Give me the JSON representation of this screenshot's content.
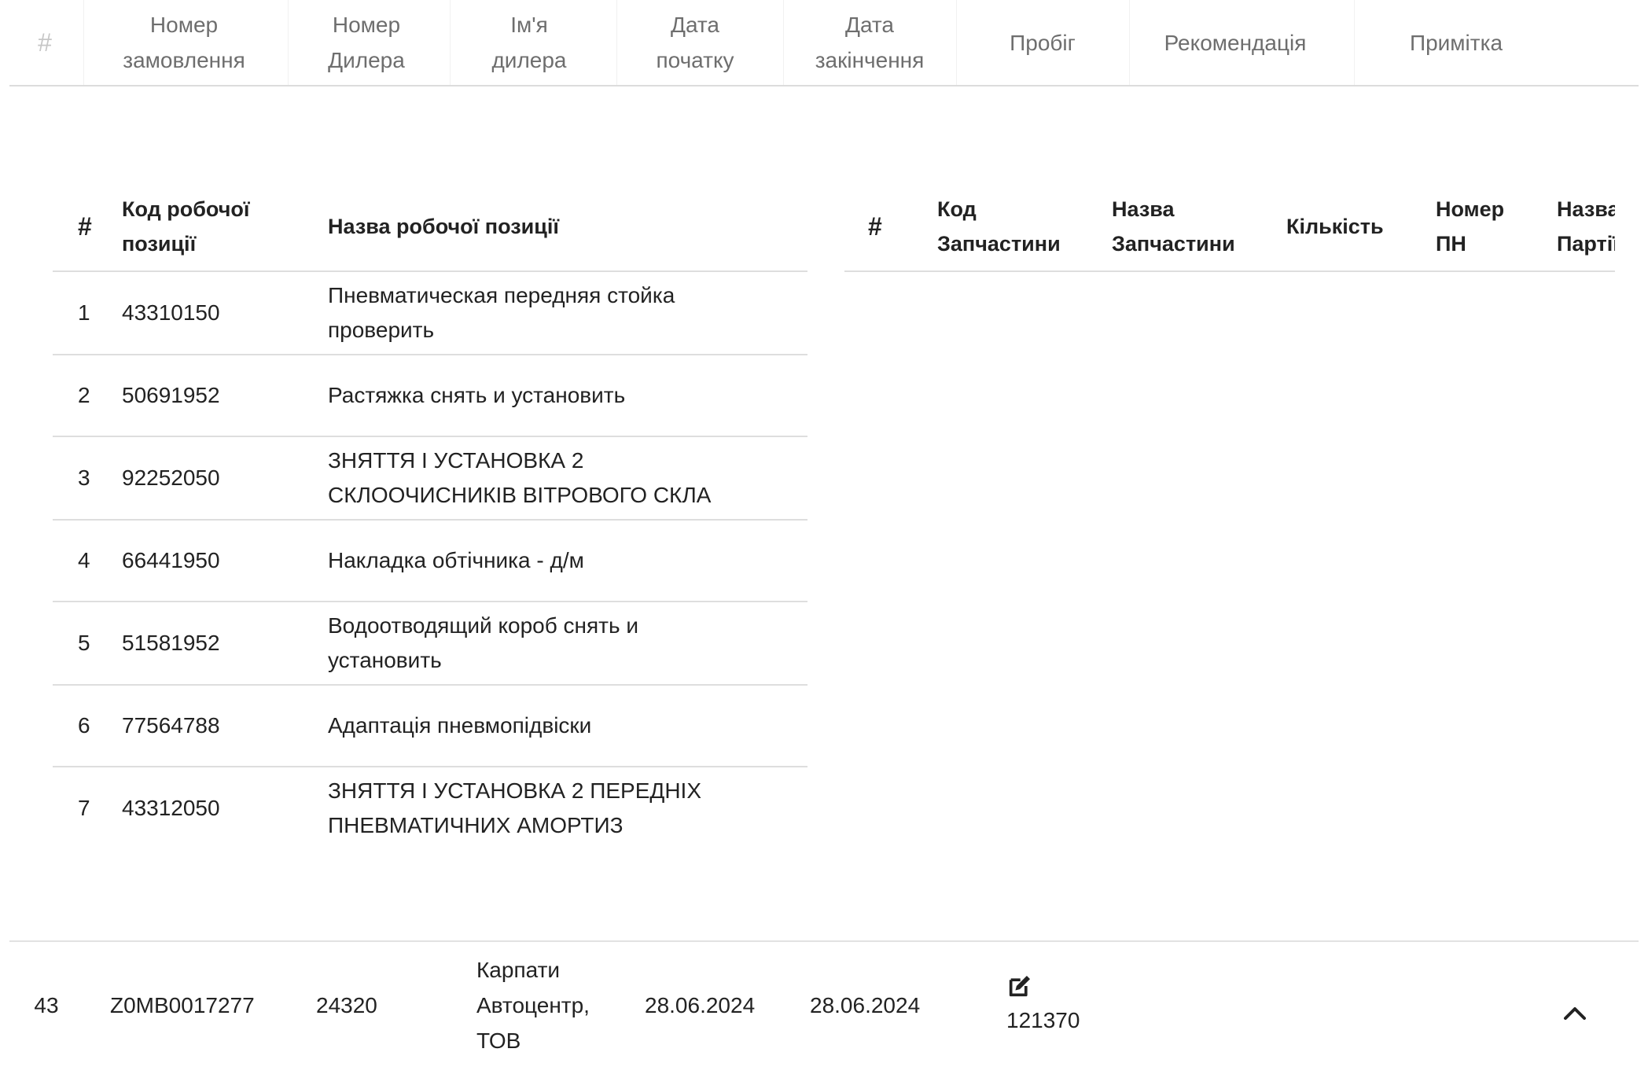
{
  "main_table": {
    "headers": {
      "hash": "#",
      "order_number": [
        "Номер",
        "замовлення"
      ],
      "dealer_number": [
        "Номер",
        "Дилера"
      ],
      "dealer_name": [
        "Ім'я",
        "дилера"
      ],
      "start_date": [
        "Дата",
        "початку"
      ],
      "end_date": [
        "Дата",
        "закінчення"
      ],
      "mileage": "Пробіг",
      "recommendation": "Рекомендація",
      "note": "Примітка"
    },
    "row": {
      "index": "43",
      "order_number": "Z0MB0017277",
      "dealer_number": "24320",
      "dealer_name": [
        "Карпати",
        "Автоцентр,",
        "ТОВ"
      ],
      "start_date": "28.06.2024",
      "end_date": "28.06.2024",
      "mileage": "121370",
      "edit_icon": "edit-icon",
      "collapse_icon": "chevron-up-icon"
    }
  },
  "works_table": {
    "headers": {
      "hash": "#",
      "code": [
        "Код робочої",
        "позиції"
      ],
      "name": "Назва робочої позиції"
    },
    "rows": [
      {
        "num": "1",
        "code": "43310150",
        "name": [
          "Пневматическая передняя стойка",
          "проверить"
        ]
      },
      {
        "num": "2",
        "code": "50691952",
        "name": [
          "Растяжка снять и установить"
        ]
      },
      {
        "num": "3",
        "code": "92252050",
        "name": [
          "ЗНЯТТЯ І УСТАНОВКА 2",
          "СКЛООЧИСНИКІВ ВІТРОВОГО СКЛА"
        ]
      },
      {
        "num": "4",
        "code": "66441950",
        "name": [
          "Накладка обтічника - д/м"
        ]
      },
      {
        "num": "5",
        "code": "51581952",
        "name": [
          "Водоотводящий короб снять и",
          "установить"
        ]
      },
      {
        "num": "6",
        "code": "77564788",
        "name": [
          "Адаптація пневмопідвіски"
        ]
      },
      {
        "num": "7",
        "code": "43312050",
        "name": [
          "ЗНЯТТЯ І УСТАНОВКА 2 ПЕРЕДНІХ",
          "ПНЕВМАТИЧНИХ АМОРТИЗ"
        ]
      }
    ]
  },
  "parts_table": {
    "headers": {
      "hash": "#",
      "code": [
        "Код",
        "Запчастини"
      ],
      "name": [
        "Назва",
        "Запчастини"
      ],
      "qty": "Кількість",
      "pn": [
        "Номер",
        "ПН"
      ],
      "party": [
        "Назва",
        "Партії"
      ]
    }
  }
}
